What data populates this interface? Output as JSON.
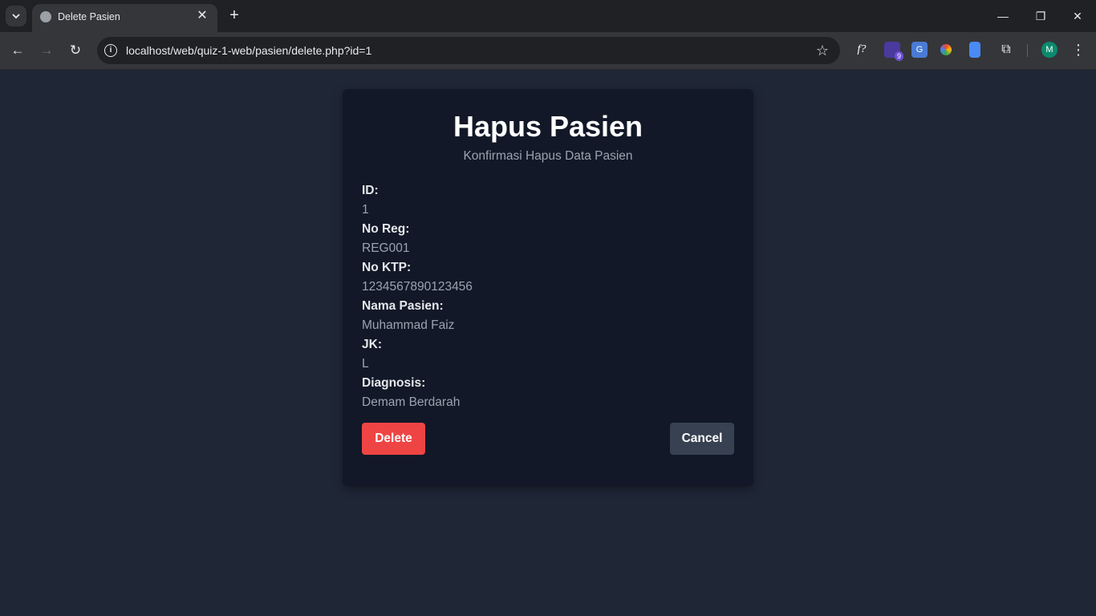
{
  "browser": {
    "tab_title": "Delete Pasien",
    "tab_close": "✕",
    "new_tab": "+",
    "url": "localhost/web/quiz-1-web/pasien/delete.php?id=1",
    "ext_badge": "9",
    "ext_f": "f?",
    "avatar_letter": "M",
    "win_min": "—",
    "win_restore": "❐",
    "win_close": "✕"
  },
  "page": {
    "title": "Hapus Pasien",
    "subtitle": "Konfirmasi Hapus Data Pasien",
    "fields": [
      {
        "label": "ID:",
        "value": "1"
      },
      {
        "label": "No Reg:",
        "value": "REG001"
      },
      {
        "label": "No KTP:",
        "value": "1234567890123456"
      },
      {
        "label": "Nama Pasien:",
        "value": "Muhammad Faiz"
      },
      {
        "label": "JK:",
        "value": "L"
      },
      {
        "label": "Diagnosis:",
        "value": "Demam Berdarah"
      }
    ],
    "delete_label": "Delete",
    "cancel_label": "Cancel"
  },
  "colors": {
    "background": "#1f2636",
    "card": "#121827",
    "delete": "#ef4444",
    "cancel": "#374151"
  }
}
